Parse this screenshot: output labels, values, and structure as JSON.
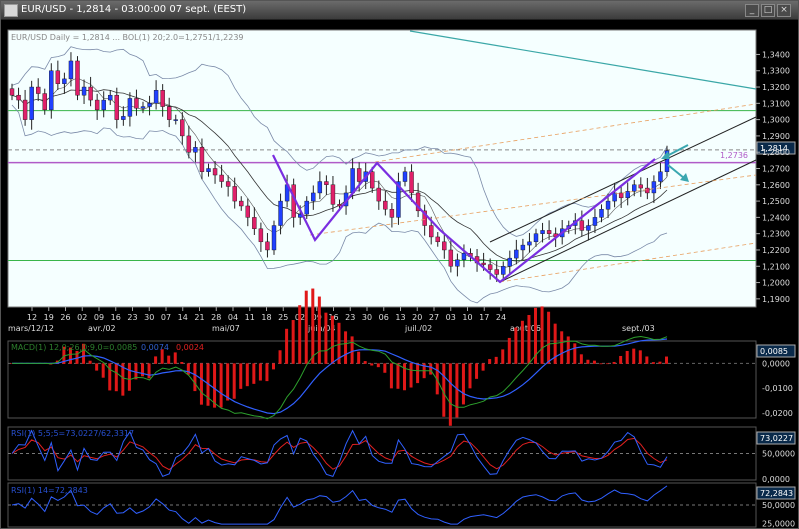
{
  "window": {
    "title": "EUR/USD - 1,2814 - 03:00:00  07 sept. (EEST)"
  },
  "chart_data": [
    {
      "type": "line",
      "name": "price",
      "legend": "EUR/USD Daily = 1,2814 ... BOL(1) 20;2.0=1,2751/1,2239",
      "ylim": [
        1.185,
        1.355
      ],
      "y_ticks": [
        "1,3400",
        "1,3300",
        "1,3200",
        "1,3100",
        "1,3000",
        "1,2900",
        "1,2800",
        "1,2700",
        "1,2600",
        "1,2500",
        "1,2400",
        "1,2300",
        "1,2200",
        "1,2100",
        "1,2000",
        "1,1900"
      ],
      "x_day_labels": [
        "12",
        "19",
        "26",
        "02",
        "09",
        "16",
        "23",
        "30",
        "07",
        "14",
        "21",
        "28",
        "04",
        "11",
        "18",
        "25",
        "02",
        "09",
        "16",
        "23",
        "30",
        "06",
        "13",
        "20",
        "27",
        "03",
        "10",
        "17",
        "24"
      ],
      "x_month_labels": [
        "mars/12/12",
        "avr./02",
        "mai/07",
        "juin/04",
        "juil./02",
        "août/06",
        "sept./03"
      ],
      "last_price_label": "1,2814",
      "level_label": "1,2736",
      "horizontal_levels": [
        1.3055,
        1.2736,
        1.2135
      ],
      "close": [
        1.315,
        1.312,
        1.3,
        1.32,
        1.316,
        1.306,
        1.33,
        1.322,
        1.325,
        1.336,
        1.315,
        1.32,
        1.312,
        1.306,
        1.312,
        1.315,
        1.3,
        1.302,
        1.313,
        1.307,
        1.308,
        1.31,
        1.318,
        1.308,
        1.3,
        1.3,
        1.29,
        1.28,
        1.283,
        1.268,
        1.27,
        1.266,
        1.262,
        1.259,
        1.25,
        1.247,
        1.24,
        1.233,
        1.225,
        1.22,
        1.235,
        1.25,
        1.26,
        1.24,
        1.242,
        1.25,
        1.255,
        1.262,
        1.26,
        1.248,
        1.247,
        1.255,
        1.27,
        1.262,
        1.268,
        1.258,
        1.25,
        1.245,
        1.24,
        1.262,
        1.268,
        1.255,
        1.244,
        1.235,
        1.228,
        1.225,
        1.22,
        1.21,
        1.214,
        1.218,
        1.216,
        1.212,
        1.211,
        1.208,
        1.205,
        1.21,
        1.215,
        1.22,
        1.223,
        1.225,
        1.23,
        1.232,
        1.23,
        1.228,
        1.233,
        1.235,
        1.238,
        1.232,
        1.235,
        1.24,
        1.245,
        1.25,
        1.255,
        1.252,
        1.256,
        1.26,
        1.258,
        1.255,
        1.262,
        1.268,
        1.281
      ]
    },
    {
      "type": "line",
      "name": "macd",
      "legend": "MACD(1) 12,0;26,0;9,0=0,0085",
      "legend_signal": "0,0074",
      "legend_hist": "0,0024",
      "value_label": "0,0085",
      "y_ticks": [
        "0,0000",
        "-0,0100",
        "-0,0200"
      ],
      "ylim": [
        -0.022,
        0.009
      ]
    },
    {
      "type": "line",
      "name": "rsi-stoch",
      "legend": "RSI(1) 5;5;5=73,0227/62,3317",
      "value_label": "73,0227",
      "y_ticks": [
        "50,0000",
        "0,0000"
      ],
      "ylim": [
        -2,
        102
      ]
    },
    {
      "type": "line",
      "name": "rsi",
      "legend": "RSI(1) 14=72,2843",
      "value_label": "72,2843",
      "y_ticks": [
        "50,0000",
        "25,0000"
      ],
      "ylim": [
        20,
        80
      ]
    }
  ]
}
